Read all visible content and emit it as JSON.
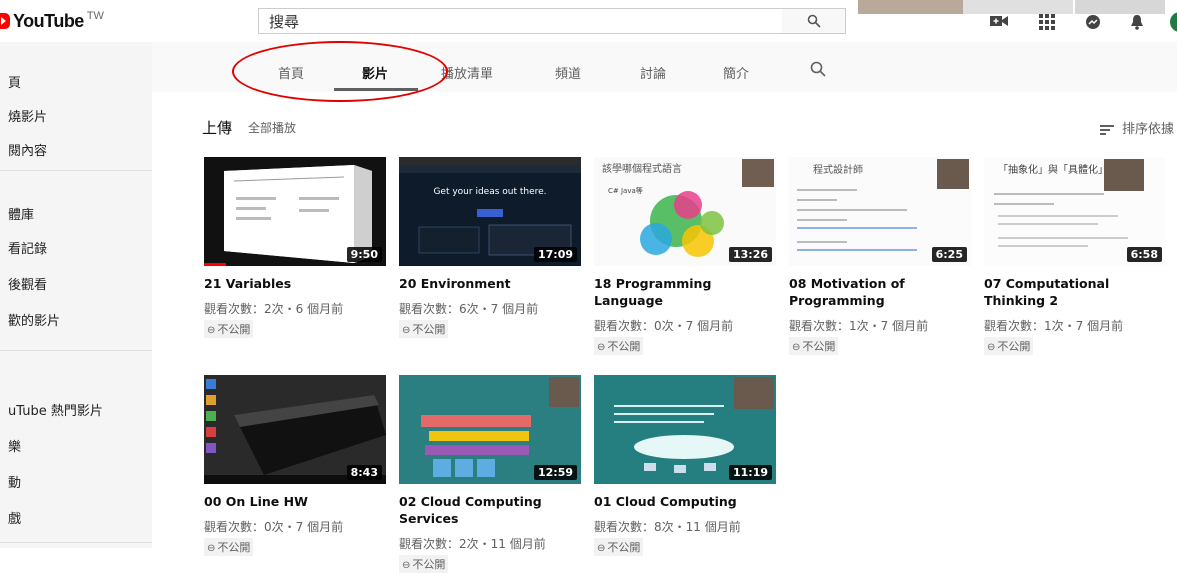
{
  "header": {
    "logo_text": "YouTube",
    "logo_region": "TW",
    "search_placeholder": "搜尋",
    "icons": [
      "search-icon",
      "video-camera-icon",
      "apps-grid-icon",
      "messages-icon",
      "bell-icon",
      "avatar"
    ]
  },
  "sidebar": {
    "items": [
      "頁",
      "燒影片",
      "閱內容",
      "體庫",
      "看記錄",
      "後觀看",
      "歡的影片",
      "uTube 熱門影片",
      "樂",
      "動",
      "戲"
    ]
  },
  "tabs": [
    {
      "label": "首頁",
      "active": false
    },
    {
      "label": "影片",
      "active": true
    },
    {
      "label": "播放清單",
      "active": false
    },
    {
      "label": "頻道",
      "active": false
    },
    {
      "label": "討論",
      "active": false
    },
    {
      "label": "簡介",
      "active": false
    }
  ],
  "section": {
    "title": "上傳",
    "play_all": "全部播放",
    "sort_label": "排序依據"
  },
  "videos": [
    {
      "title": "21 Variables",
      "duration": "9:50",
      "views": "觀看次數：2次・6 個月前",
      "badge": "不公開",
      "progress": 0.12
    },
    {
      "title": "20 Environment",
      "duration": "17:09",
      "views": "觀看次數：6次・7 個月前",
      "badge": "不公開",
      "progress": 0
    },
    {
      "title": "18 Programming Language",
      "duration": "13:26",
      "views": "觀看次數：0次・7 個月前",
      "badge": "不公開",
      "progress": 0
    },
    {
      "title": "08 Motivation of Programming",
      "duration": "6:25",
      "views": "觀看次數：1次・7 個月前",
      "badge": "不公開",
      "progress": 0
    },
    {
      "title": "07 Computational Thinking 2",
      "duration": "6:58",
      "views": "觀看次數：1次・7 個月前",
      "badge": "不公開",
      "progress": 0
    },
    {
      "title": "00 On Line HW",
      "duration": "8:43",
      "views": "觀看次數：0次・7 個月前",
      "badge": "不公開",
      "progress": 0
    },
    {
      "title": "02 Cloud Computing Services",
      "duration": "12:59",
      "views": "觀看次數：2次・11 個月前",
      "badge": "不公開",
      "progress": 0
    },
    {
      "title": "01 Cloud Computing",
      "duration": "11:19",
      "views": "觀看次數：8次・11 個月前",
      "badge": "不公開",
      "progress": 0
    }
  ],
  "slide_text": {
    "v3_heading": "該學哪個程式語言",
    "v3_bullet": "C# Java等",
    "v4_heading": "程式設計師",
    "v5_heading": "「抽象化」與「具體化」",
    "v2_heading": "Get your ideas out there."
  },
  "colors": {
    "accent": "#ff0000",
    "annotation": "#e00000"
  }
}
